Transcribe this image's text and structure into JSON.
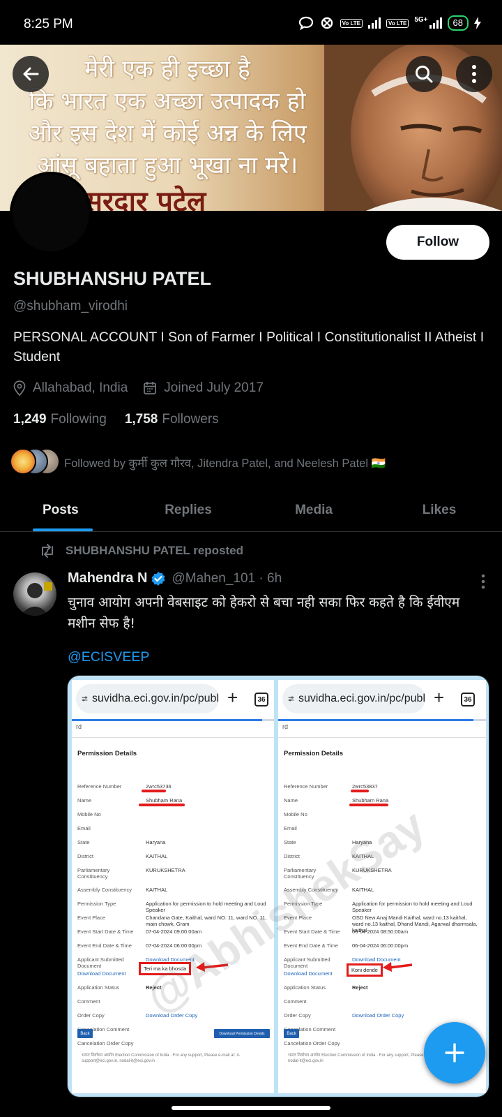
{
  "status_bar": {
    "time": "8:25 PM",
    "lte1": "Vo LTE",
    "lte2": "Vo LTE",
    "network": "5G+",
    "battery": "68"
  },
  "banner": {
    "quote_lines": [
      "मेरी एक ही इच्छा है",
      "कि भारत एक अच्छा उत्पादक हो",
      "और इस देश में कोई अन्न के लिए",
      "आंसू बहाता हुआ भूखा ना मरे।"
    ],
    "name": "सरदार पटेल"
  },
  "profile": {
    "follow_label": "Follow",
    "display_name": "SHUBHANSHU PATEL",
    "handle": "@shubham_virodhi",
    "bio": "PERSONAL ACCOUNT I Son of Farmer I Political I Constitutionalist II Atheist I Student",
    "location": "Allahabad, India",
    "joined": "Joined July 2017",
    "following_count": "1,249",
    "following_label": "Following",
    "followers_count": "1,758",
    "followers_label": "Followers",
    "followed_by": "Followed by कुर्मी कुल गौरव, Jitendra Patel, and Neelesh Patel 🇮🇳"
  },
  "tabs": [
    {
      "label": "Posts",
      "active": true
    },
    {
      "label": "Replies",
      "active": false
    },
    {
      "label": "Media",
      "active": false
    },
    {
      "label": "Likes",
      "active": false
    }
  ],
  "post": {
    "repost_label": "SHUBHANSHU PATEL reposted",
    "author_name": "Mahendra N",
    "author_handle": "@Mahen_101 · 6h",
    "text": "चुनाव आयोग अपनी वेबसाइट को हेकरो से बचा नही सका फिर कहते है कि ईवीएम मशीन सेफ है!",
    "mention": "@ECISVEEP"
  },
  "screenshots": [
    {
      "url": "suvidha.eci.gov.in/pc/publ",
      "tab_count": "36",
      "crumb": "rd",
      "title": "Permission Details",
      "rows": [
        {
          "k": "Reference Number",
          "v": "2wrc53736"
        },
        {
          "k": "Name",
          "v": "Shubham Rana"
        },
        {
          "k": "Mobile No",
          "v": ""
        },
        {
          "k": "Email",
          "v": ""
        },
        {
          "k": "State",
          "v": "Haryana"
        },
        {
          "k": "District",
          "v": "KAITHAL"
        },
        {
          "k": "Parliamentary Constituency",
          "v": "KURUKSHETRA"
        },
        {
          "k": "Assembly Constituency",
          "v": "KAITHAL"
        },
        {
          "k": "Permission Type",
          "v": "Application for permission to hold meeting and Loud Speaker"
        },
        {
          "k": "Event Place",
          "v": "Chandana Gate, Kaithal, ward NO. 11, ward NO. 11, main chowk, Gram"
        },
        {
          "k": "Event Start Date & Time",
          "v": "07-04-2024 09:00:00am"
        },
        {
          "k": "Event End Date & Time",
          "v": "07-04-2024 06:00:00pm"
        },
        {
          "k": "Applicant Submitted Document",
          "v": "Download Document"
        },
        {
          "k": "Download Document",
          "v": ""
        },
        {
          "k": "Application Status",
          "v": "Reject"
        },
        {
          "k": "Comment",
          "v": "Teri ma ka bhosda"
        },
        {
          "k": "Order Copy",
          "v": "Download Order Copy"
        },
        {
          "k": "Cancelation Comment",
          "v": ""
        },
        {
          "k": "Cancelation Order Copy",
          "v": ""
        }
      ],
      "back_label": "Back",
      "download_label": "Download Permission Details",
      "footer": "भारत निर्वाचन आयोग Election Commission of India · For any support, Please e-mail at: it-support@eci.gov.in, nodal-it@eci.gov.in"
    },
    {
      "url": "suvidha.eci.gov.in/pc/publ",
      "tab_count": "36",
      "crumb": "rd",
      "title": "Permission Details",
      "rows": [
        {
          "k": "Reference Number",
          "v": "2wrc53837"
        },
        {
          "k": "Name",
          "v": "Shubham Rana"
        },
        {
          "k": "Mobile No",
          "v": ""
        },
        {
          "k": "Email",
          "v": ""
        },
        {
          "k": "State",
          "v": "Haryana"
        },
        {
          "k": "District",
          "v": "KAITHAL"
        },
        {
          "k": "Parliamentary Constituency",
          "v": "KURUKSHETRA"
        },
        {
          "k": "Assembly Constituency",
          "v": "KAITHAL"
        },
        {
          "k": "Permission Type",
          "v": "Application for permission to hold meeting and Loud Speaker"
        },
        {
          "k": "Event Place",
          "v": "OSD New Anaj Mandi Kaithal, ward no.13 kaithal, ward no.13 kaithal, Dhand Mandi, Agarwal dharmsala, kaithal"
        },
        {
          "k": "Event Start Date & Time",
          "v": "06-04-2024 08:50:00am"
        },
        {
          "k": "Event End Date & Time",
          "v": "06-04-2024 06:00:00pm"
        },
        {
          "k": "Applicant Submitted Document",
          "v": "Download Document"
        },
        {
          "k": "Download Document",
          "v": ""
        },
        {
          "k": "Application Status",
          "v": "Reject"
        },
        {
          "k": "Comment",
          "v": "Koni dende"
        },
        {
          "k": "Order Copy",
          "v": "Download Order Copy"
        },
        {
          "k": "Cancelation Comment",
          "v": ""
        },
        {
          "k": "Cancelation Order Copy",
          "v": ""
        }
      ],
      "back_label": "Back",
      "footer": "भारत निर्वाचन आयोग Election Commission of India · For any support, Please e-mail at: it-support@eci.gov.in, nodal-it@eci.gov.in"
    }
  ],
  "watermark": "@AbhishekSay",
  "colors": {
    "accent": "#1d9bf0",
    "background": "#000000",
    "muted": "#71767b",
    "text": "#e7e9ea",
    "highlight_red": "#e31b1b"
  }
}
